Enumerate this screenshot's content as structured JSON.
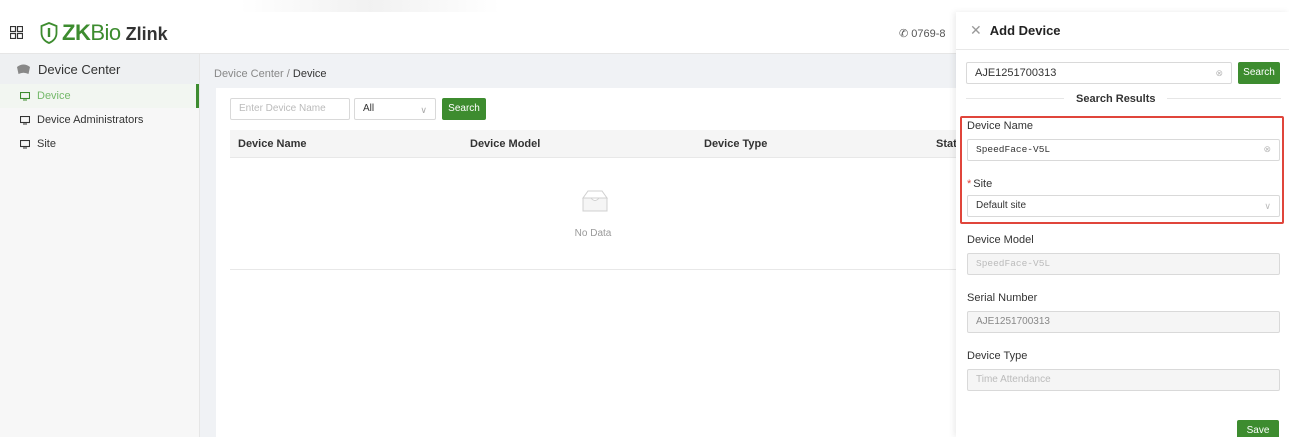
{
  "app": {
    "brand_zk": "ZK",
    "brand_bio": "Bio",
    "brand_zlink": "Zlink",
    "phone": "0769-8"
  },
  "sidebar": {
    "header": "Device Center",
    "items": [
      {
        "label": "Device",
        "active": true
      },
      {
        "label": "Device Administrators",
        "active": false
      },
      {
        "label": "Site",
        "active": false
      }
    ]
  },
  "breadcrumb": {
    "parent": "Device Center",
    "separator": "/",
    "current": "Device"
  },
  "filter": {
    "name_placeholder": "Enter Device Name",
    "select_value": "All",
    "search_label": "Search"
  },
  "table": {
    "columns": [
      "Device Name",
      "Device Model",
      "Device Type",
      "Stat"
    ],
    "empty_text": "No Data"
  },
  "drawer": {
    "title": "Add Device",
    "search_value": "AJE1251700313",
    "search_label": "Search",
    "results_label": "Search Results",
    "device_name_label": "Device Name",
    "device_name_value": "SpeedFace-V5L",
    "site_label": "Site",
    "site_required_mark": "*",
    "site_value": "Default site",
    "device_model_label": "Device Model",
    "device_model_value": "SpeedFace-V5L",
    "serial_label": "Serial Number",
    "serial_value": "AJE1251700313",
    "device_type_label": "Device Type",
    "device_type_value": "Time Attendance",
    "save_label": "Save"
  },
  "colors": {
    "brand_green": "#3d8c2f",
    "highlight_red": "#e0453b"
  },
  "icons": [
    "menu-grid-icon",
    "shield-logo-icon",
    "phone-icon",
    "device-center-icon",
    "monitor-icon",
    "empty-box-icon",
    "close-icon",
    "clear-icon",
    "chevron-down-icon"
  ]
}
